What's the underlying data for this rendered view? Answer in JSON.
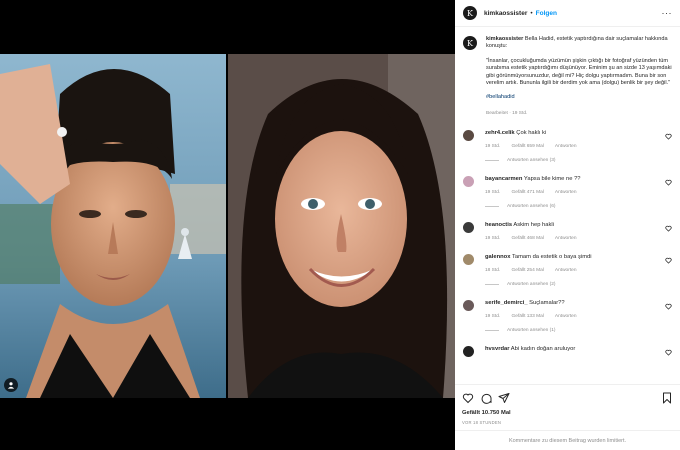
{
  "post": {
    "username": "kimkaossister",
    "avatar_letter": "K",
    "follow_label": "Folgen",
    "dot": "•",
    "more_label": "···"
  },
  "caption": {
    "username": "kimkaossister",
    "intro": "Bella Hadid, estetik yaptırdığına dair suçlamalar hakkında konuştu:",
    "quote": "\"İnsanlar, çocukluğumda yüzümün şişkin çıktığı bir fotoğraf yüzünden tüm surabıma estetik yaptırdığımı düşünüyor. Eminim şu an sizde 13 yaşımdaki gibi görünmüyorsunuzdur, değil mi? Hiç dolgu yaptırmadım. Buna bir son verelim artık. Bununla ilgili bir derdim yok ama (dolgu) benlik bir şey değil.\"",
    "hashtag": "#bellahadid",
    "edited": "Bearbeitet · 19 Std."
  },
  "comments": [
    {
      "user": "zehr4.celik",
      "text": "Çok haklı ki",
      "time": "19 Std.",
      "likes": "Gefällt 659 Mal",
      "reply": "Antworten",
      "replies": "Antworten ansehen (3)",
      "avatar_color": "#5a4a42"
    },
    {
      "user": "bayancarmen",
      "text": "Yapsa bile kime ne ??",
      "time": "19 Std.",
      "likes": "Gefällt 471 Mal",
      "reply": "Antworten",
      "replies": "Antworten ansehen (6)",
      "avatar_color": "#c9a0b5"
    },
    {
      "user": "heanoctis",
      "text": "Askim hep hakli",
      "time": "19 Std.",
      "likes": "Gefällt 468 Mal",
      "reply": "Antworten",
      "replies": "",
      "avatar_color": "#3a3a3a"
    },
    {
      "user": "galennox",
      "text": "Tamam da estetik o baya şimdi",
      "time": "18 Std.",
      "likes": "Gefällt 254 Mal",
      "reply": "Antworten",
      "replies": "Antworten ansehen (2)",
      "avatar_color": "#a08a6a"
    },
    {
      "user": "serife_demirci_",
      "text": "Suçlamalar??",
      "time": "19 Std.",
      "likes": "Gefällt 133 Mal",
      "reply": "Antworten",
      "replies": "Antworten ansehen (1)",
      "avatar_color": "#6a5a5a"
    },
    {
      "user": "hvsvrdar",
      "text": "Abi kadın doğan aruluyor",
      "time": "",
      "likes": "",
      "reply": "",
      "replies": "",
      "avatar_color": "#222222"
    }
  ],
  "footer": {
    "likes": "Gefällt 10.750 Mal",
    "time": "VOR 18 STUNDEN",
    "disabled": "Kommentare zu diesem Beitrag wurden limitiert."
  }
}
